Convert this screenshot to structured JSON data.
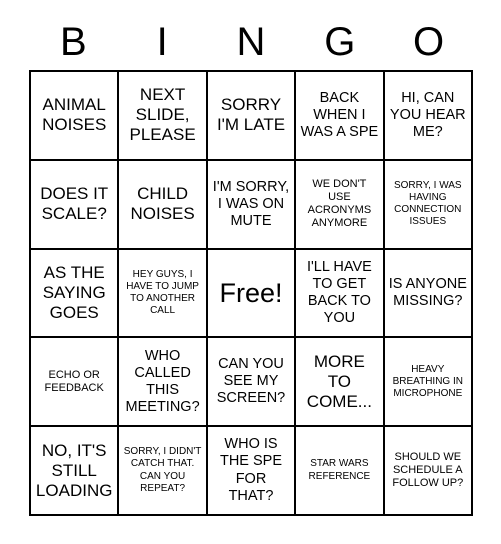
{
  "card": {
    "title": "BINGO",
    "header_letters": [
      "B",
      "I",
      "N",
      "G",
      "O"
    ],
    "grid_size": "5x5",
    "free_space": "Free!",
    "colors": {
      "background": "#ffffff",
      "text": "#000000",
      "border": "#000000"
    }
  },
  "squares": [
    [
      {
        "text": "ANIMAL NOISES",
        "size": "lg",
        "free": false
      },
      {
        "text": "NEXT SLIDE, PLEASE",
        "size": "lg",
        "free": false
      },
      {
        "text": "SORRY I'M LATE",
        "size": "lg",
        "free": false
      },
      {
        "text": "BACK WHEN I WAS A SPE",
        "size": "md",
        "free": false
      },
      {
        "text": "HI, CAN YOU HEAR ME?",
        "size": "md",
        "free": false
      }
    ],
    [
      {
        "text": "DOES IT SCALE?",
        "size": "lg",
        "free": false
      },
      {
        "text": "CHILD NOISES",
        "size": "lg",
        "free": false
      },
      {
        "text": "I'M SORRY, I WAS ON MUTE",
        "size": "md",
        "free": false
      },
      {
        "text": "WE DON'T USE ACRONYMS ANYMORE",
        "size": "sm",
        "free": false
      },
      {
        "text": "SORRY, I WAS HAVING CONNECTION ISSUES",
        "size": "xs",
        "free": false
      }
    ],
    [
      {
        "text": "AS THE SAYING GOES",
        "size": "lg",
        "free": false
      },
      {
        "text": "HEY GUYS, I HAVE TO JUMP TO ANOTHER CALL",
        "size": "xs",
        "free": false
      },
      {
        "text": "Free!",
        "size": "xl",
        "free": true
      },
      {
        "text": "I'LL HAVE TO GET BACK TO YOU",
        "size": "md",
        "free": false
      },
      {
        "text": "IS ANYONE MISSING?",
        "size": "md",
        "free": false
      }
    ],
    [
      {
        "text": "ECHO OR FEEDBACK",
        "size": "sm",
        "free": false
      },
      {
        "text": "WHO CALLED THIS MEETING?",
        "size": "md",
        "free": false
      },
      {
        "text": "CAN YOU SEE MY SCREEN?",
        "size": "md",
        "free": false
      },
      {
        "text": "MORE TO COME...",
        "size": "lg",
        "free": false
      },
      {
        "text": "HEAVY BREATHING IN MICROPHONE",
        "size": "xs",
        "free": false
      }
    ],
    [
      {
        "text": "NO, IT'S STILL LOADING",
        "size": "lg",
        "free": false
      },
      {
        "text": "SORRY, I DIDN'T CATCH THAT. CAN YOU REPEAT?",
        "size": "xs",
        "free": false
      },
      {
        "text": "WHO IS THE SPE FOR THAT?",
        "size": "md",
        "free": false
      },
      {
        "text": "STAR WARS REFERENCE",
        "size": "xs",
        "free": false
      },
      {
        "text": "SHOULD WE SCHEDULE A FOLLOW UP?",
        "size": "sm",
        "free": false
      }
    ]
  ]
}
